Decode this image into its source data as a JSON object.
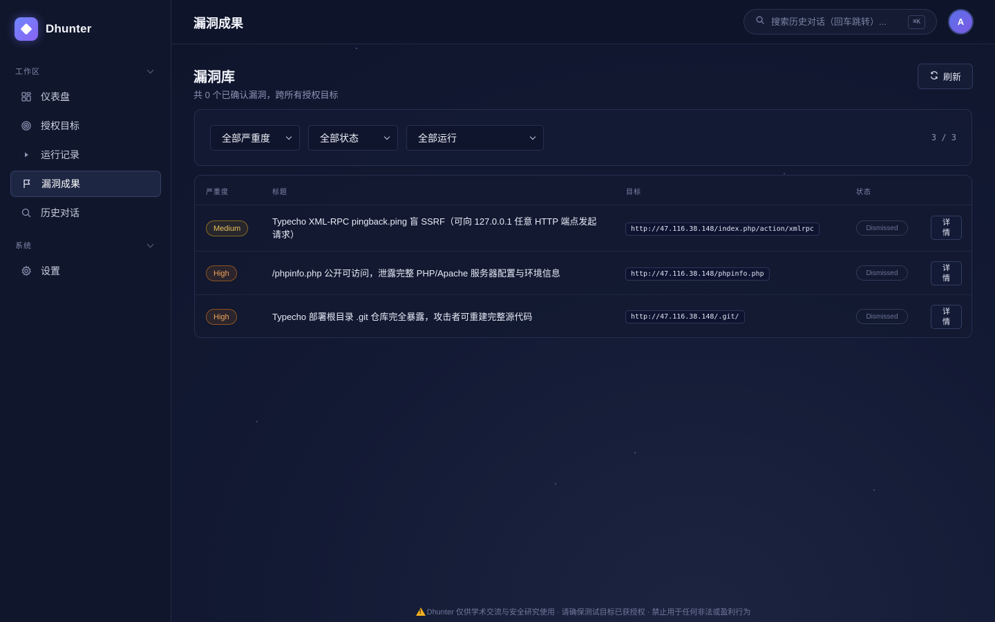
{
  "brand": {
    "name": "Dhunter"
  },
  "sidebar": {
    "workspace_label": "工作区",
    "system_label": "系统",
    "items": [
      {
        "label": "仪表盘",
        "icon": "dashboard-icon"
      },
      {
        "label": "授权目标",
        "icon": "target-icon"
      },
      {
        "label": "运行记录",
        "icon": "play-icon"
      },
      {
        "label": "漏洞成果",
        "icon": "flag-icon",
        "active": true
      },
      {
        "label": "历史对话",
        "icon": "search-icon"
      }
    ],
    "system_items": [
      {
        "label": "设置",
        "icon": "gear-icon"
      }
    ]
  },
  "header": {
    "title": "漏洞成果",
    "search_placeholder": "搜索历史对话（回车跳转）...",
    "search_shortcut": "⌘K",
    "avatar_initial": "A"
  },
  "main": {
    "title": "漏洞库",
    "subtitle": "共 0 个已确认漏洞，跨所有授权目标",
    "refresh_label": "刷新",
    "filters": {
      "severity": "全部严重度",
      "status": "全部状态",
      "run": "全部运行",
      "count": "3 / 3"
    },
    "table": {
      "columns": [
        "严重度",
        "标题",
        "目标",
        "状态"
      ],
      "detail_label": "详情",
      "rows": [
        {
          "severity": "Medium",
          "title": "Typecho XML-RPC pingback.ping 盲 SSRF（可向 127.0.0.1 任意 HTTP 端点发起请求）",
          "target": "http://47.116.38.148/index.php/action/xmlrpc",
          "status": "Dismissed"
        },
        {
          "severity": "High",
          "title": "/phpinfo.php 公开可访问，泄露完整 PHP/Apache 服务器配置与环境信息",
          "target": "http://47.116.38.148/phpinfo.php",
          "status": "Dismissed"
        },
        {
          "severity": "High",
          "title": "Typecho 部署根目录 .git 仓库完全暴露，攻击者可重建完整源代码",
          "target": "http://47.116.38.148/.git/",
          "status": "Dismissed"
        }
      ]
    }
  },
  "footer": {
    "text": "Dhunter 仅供学术交流与安全研究使用 · 请确保测试目标已获授权 · 禁止用于任何非法或盈利行为"
  },
  "colors": {
    "accent": "#6f86ff",
    "severity_medium": "#e8c15a",
    "severity_high": "#f0a35a",
    "warning": "#f2b01e"
  }
}
